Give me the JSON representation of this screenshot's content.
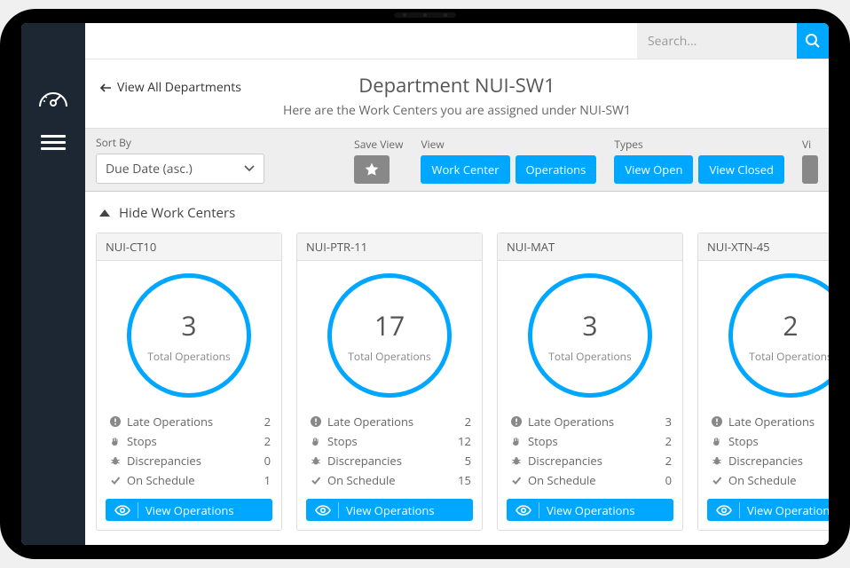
{
  "search": {
    "placeholder": "Search..."
  },
  "header": {
    "back_label": "View All Departments",
    "title": "Department NUI-SW1",
    "subtitle": "Here are the Work Centers you are assigned under NUI-SW1"
  },
  "toolbar": {
    "sort_label": "Sort By",
    "sort_selected": "Due Date (asc.)",
    "save_view_label": "Save View",
    "view_label": "View",
    "types_label": "Types",
    "partial_right_label": "Vi",
    "buttons": {
      "work_center": "Work Center",
      "operations": "Operations",
      "view_open": "View Open",
      "view_closed": "View Closed"
    }
  },
  "collapse": {
    "label": "Hide Work Centers"
  },
  "common": {
    "total_operations": "Total Operations",
    "late_operations": "Late Operations",
    "stops": "Stops",
    "discrepancies": "Discrepancies",
    "on_schedule": "On Schedule",
    "view_operations": "View Operations"
  },
  "cards": [
    {
      "title": "NUI-CT10",
      "count": "3",
      "late": "2",
      "stops": "2",
      "discrepancies": "0",
      "on_schedule": "1"
    },
    {
      "title": "NUI-PTR-11",
      "count": "17",
      "late": "2",
      "stops": "12",
      "discrepancies": "5",
      "on_schedule": "15"
    },
    {
      "title": "NUI-MAT",
      "count": "3",
      "late": "3",
      "stops": "2",
      "discrepancies": "2",
      "on_schedule": "0"
    },
    {
      "title": "NUI-XTN-45",
      "count": "2",
      "late": "",
      "stops": "",
      "discrepancies": "",
      "on_schedule": ""
    }
  ]
}
